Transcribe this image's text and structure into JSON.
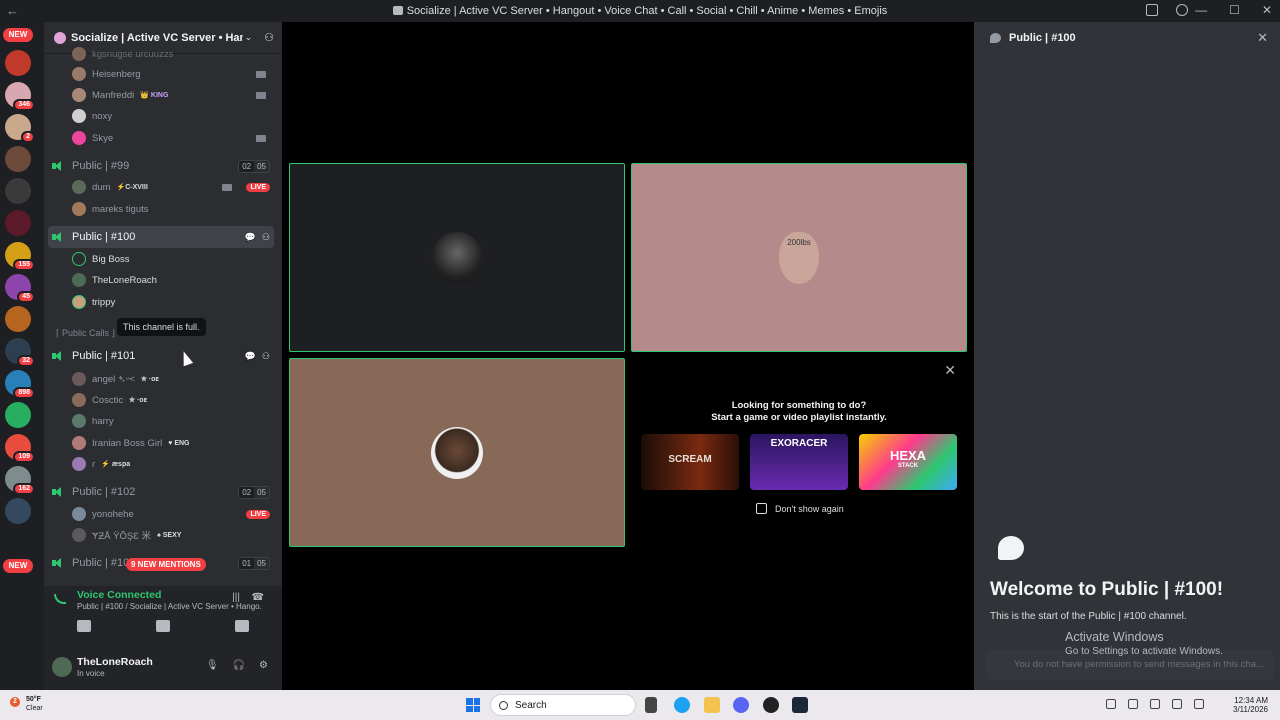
{
  "window": {
    "title": "Socialize | Active VC Server • Hangout • Voice Chat • Call • Social • Chill • Anime • Memes • Emojis",
    "nav_back": "←"
  },
  "servers": {
    "new_top": "NEW",
    "new_bottom": "NEW",
    "badges": [
      "346",
      "2",
      "155",
      "45",
      "32",
      "898",
      "109",
      "162"
    ]
  },
  "server_header": {
    "name": "Socialize | Active VC Server • Han...",
    "chevron": "⌄"
  },
  "channels": [
    {
      "name": "Public | #99",
      "count": "02",
      "limit": "05"
    },
    {
      "name": "Public | #100"
    },
    {
      "name": "Public | #101"
    },
    {
      "name": "Public | #102",
      "count": "02",
      "limit": "05"
    },
    {
      "name": "Public | #10",
      "count": "01",
      "limit": "05"
    }
  ],
  "category": "⌈ Public Calls ⌋",
  "users": {
    "top0": "kgsnugse urcuuzzs",
    "top1": "Heisenberg",
    "top2": "Manfreddi",
    "top2_tag": "👑 KING",
    "top3": "noxy",
    "top4": "Skye",
    "c99_0": "dum",
    "c99_0_tag": "⚡C-XVIII",
    "c99_1": "mareks tiguts",
    "c100_0": "Big Boss",
    "c100_1": "TheLoneRoach",
    "c100_2": "trippy",
    "c101_0": "angel ➴ᵕ<",
    "c101_0_tag": "✮ ·ᴏᴇ",
    "c101_1": "Cosctic",
    "c101_1_tag": "✮ ·ᴏᴇ",
    "c101_2": "harry",
    "c101_3": "Iranian Boss Girl",
    "c101_3_tag": "♥ ENG",
    "c101_4": "ɾ",
    "c101_4_tag": "⚡ æspa",
    "c102_0": "yonohehe",
    "c102_1": "ɎƵÅ ŸÕŞƐ 米",
    "c102_1_tag": "♠ SEXY"
  },
  "live_label": "LIVE",
  "tooltip": "This channel is full.",
  "mentions": "9 NEW MENTIONS",
  "voice": {
    "status": "Voice Connected",
    "subtitle": "Public | #100 / Socialize | Active VC Server • Hango..."
  },
  "user_panel": {
    "name": "TheLoneRoach",
    "status": "In voice"
  },
  "activity": {
    "close": "✕",
    "line1": "Looking for something to do?",
    "line2": "Start a game or video playlist instantly.",
    "games": [
      "SCREAM",
      "EXORACER",
      "HEXA"
    ],
    "game3_sub": "STACK",
    "checkbox_label": "Don't show again"
  },
  "tile_text": "200lbs",
  "chat": {
    "channel": "Public | #100",
    "close": "✕",
    "welcome": "Welcome to Public | #100!",
    "subtitle": "This is the start of the Public | #100 channel.",
    "no_permission": "You do not have permission to send messages in this cha..."
  },
  "activate_windows": {
    "title": "Activate Windows",
    "subtitle": "Go to Settings to activate Windows."
  },
  "taskbar": {
    "weather_count": "2",
    "temp": "50°F",
    "condition": "Clear",
    "search": "Search",
    "time": "12:34 AM",
    "date": "3/11/2026"
  },
  "colors": {
    "green": "#2dc770",
    "red": "#f23f43",
    "tile_pink": "#b48b8a",
    "tile_brown": "#886856"
  }
}
